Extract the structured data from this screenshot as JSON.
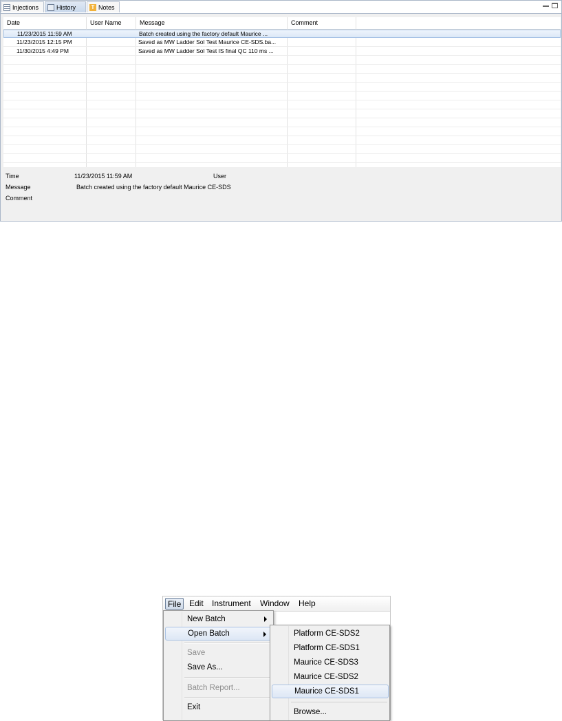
{
  "tabs": [
    {
      "label": "Injections",
      "icon": "table-icon",
      "active": false
    },
    {
      "label": "History",
      "icon": "history-icon",
      "active": true
    },
    {
      "label": "Notes",
      "icon": "notes-icon",
      "active": false
    }
  ],
  "grid": {
    "columns": [
      "Date",
      "User Name",
      "Message",
      "Comment"
    ],
    "rows": [
      {
        "date": "11/23/2015 11:59 AM",
        "user": "",
        "message": "Batch created using the factory default Maurice ...",
        "comment": ""
      },
      {
        "date": "11/23/2015 12:15 PM",
        "user": "",
        "message": "Saved as MW Ladder Sol Test Maurice CE-SDS.ba...",
        "comment": ""
      },
      {
        "date": "11/30/2015 4:49 PM",
        "user": "",
        "message": "Saved as MW Ladder Sol Test IS final QC 110 ms ...",
        "comment": ""
      }
    ]
  },
  "details": {
    "time_label": "Time",
    "time_value": "11/23/2015 11:59 AM",
    "user_label": "User",
    "message_label": "Message",
    "message_value": "Batch created using the factory default Maurice CE-SDS",
    "comment_label": "Comment"
  },
  "menubar": [
    "File",
    "Edit",
    "Instrument",
    "Window",
    "Help"
  ],
  "file_menu": {
    "new_batch": "New Batch",
    "open_batch": "Open Batch",
    "save": "Save",
    "save_as": "Save As...",
    "batch_report": "Batch Report...",
    "exit": "Exit"
  },
  "open_batch_submenu": {
    "items": [
      "Platform CE-SDS2",
      "Platform CE-SDS1",
      "Maurice CE-SDS3",
      "Maurice CE-SDS2",
      "Maurice CE-SDS1"
    ],
    "browse": "Browse..."
  },
  "colors": {
    "selection": "#dbe8f7",
    "tab_active": "#c9d8ec",
    "border": "#a9b6c8"
  }
}
